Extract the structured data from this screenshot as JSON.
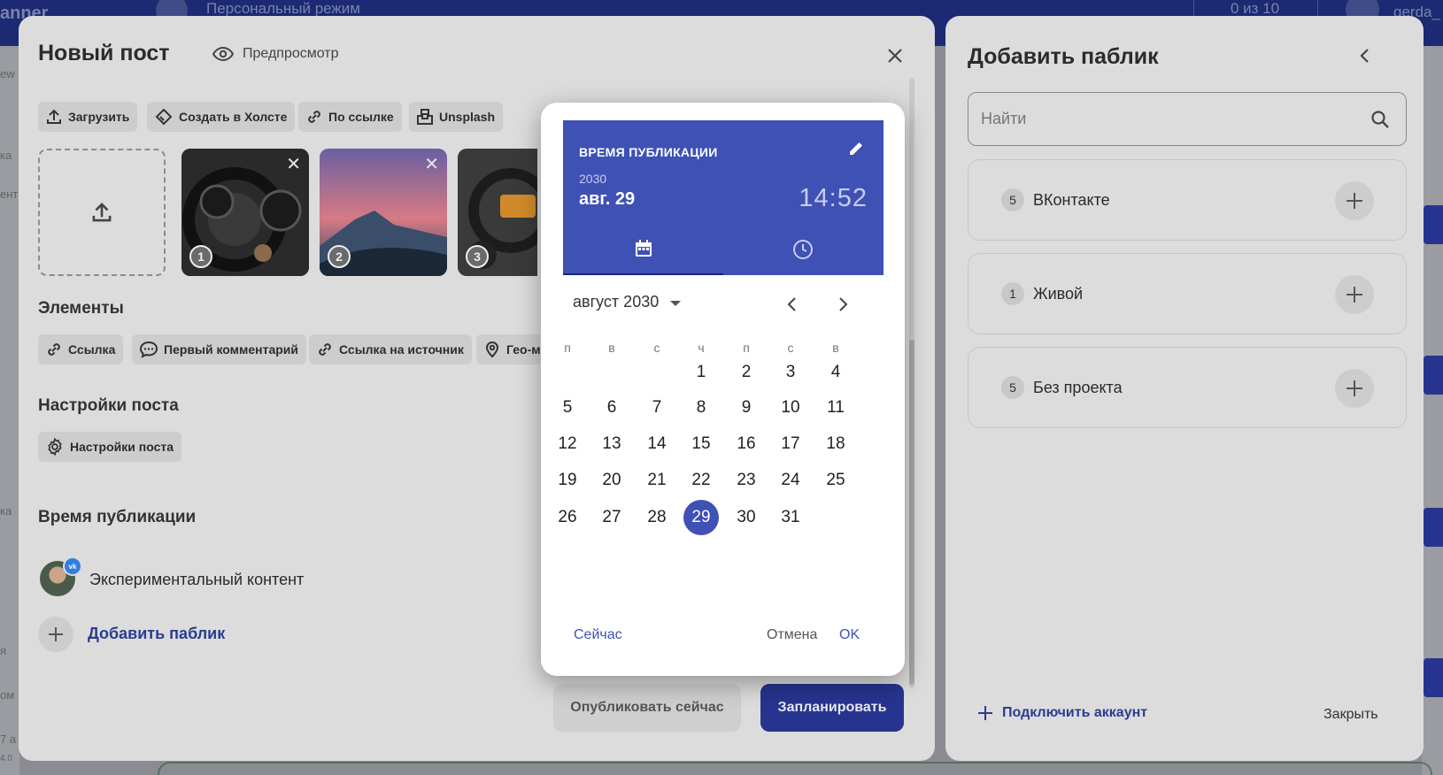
{
  "background": {
    "topbar_left": "anner",
    "topbar_mode": "Персональный режим",
    "topbar_counter": "0 из 10",
    "topbar_user": "gerda_",
    "leftnav_fragments": [
      "ew",
      "ка",
      "ент",
      "ка",
      "я",
      "ом",
      "7 а",
      "4.0"
    ]
  },
  "post": {
    "title": "Новый пост",
    "preview_label": "Предпросмотр",
    "media_buttons": [
      "Загрузить",
      "Создать в Холсте",
      "По ссылке",
      "Unsplash"
    ],
    "thumbnails": [
      {
        "number": "1",
        "subject": "car dashboard"
      },
      {
        "number": "2",
        "subject": "mountain at sunset"
      },
      {
        "number": "3",
        "subject": "car gauges"
      }
    ],
    "elements_title": "Элементы",
    "element_chips": [
      "Ссылка",
      "Первый комментарий",
      "Ссылка на источник",
      "Гео-м"
    ],
    "settings_title": "Настройки поста",
    "settings_chip": "Настройки поста",
    "time_title": "Время публикации",
    "channel_name": "Экспериментальный контент",
    "channel_badge": "vk",
    "add_public_label": "Добавить паблик",
    "publish_now_label": "Опубликовать сейчас",
    "schedule_label": "Запланировать"
  },
  "add_public": {
    "title": "Добавить паблик",
    "search_placeholder": "Найти",
    "items": [
      {
        "count": "5",
        "name": "ВКонтакте"
      },
      {
        "count": "1",
        "name": "Живой"
      },
      {
        "count": "5",
        "name": "Без проекта"
      }
    ],
    "connect_label": "Подключить аккаунт",
    "close_label": "Закрыть"
  },
  "picker": {
    "header_label": "ВРЕМЯ ПУБЛИКАЦИИ",
    "year": "2030",
    "date": "авг. 29",
    "time": "14:52",
    "month_label": "август 2030",
    "weekdays": [
      "п",
      "в",
      "с",
      "ч",
      "п",
      "с",
      "в"
    ],
    "first_weekday_index": 3,
    "days_in_month": 31,
    "selected_day": 29,
    "now_label": "Сейчас",
    "cancel_label": "Отмена",
    "ok_label": "OK"
  },
  "colors": {
    "accent": "#3f51b5",
    "accent_dark": "#1a237e",
    "schedule_button": "#27348f",
    "overlay_panel": "#dcdcdc"
  }
}
